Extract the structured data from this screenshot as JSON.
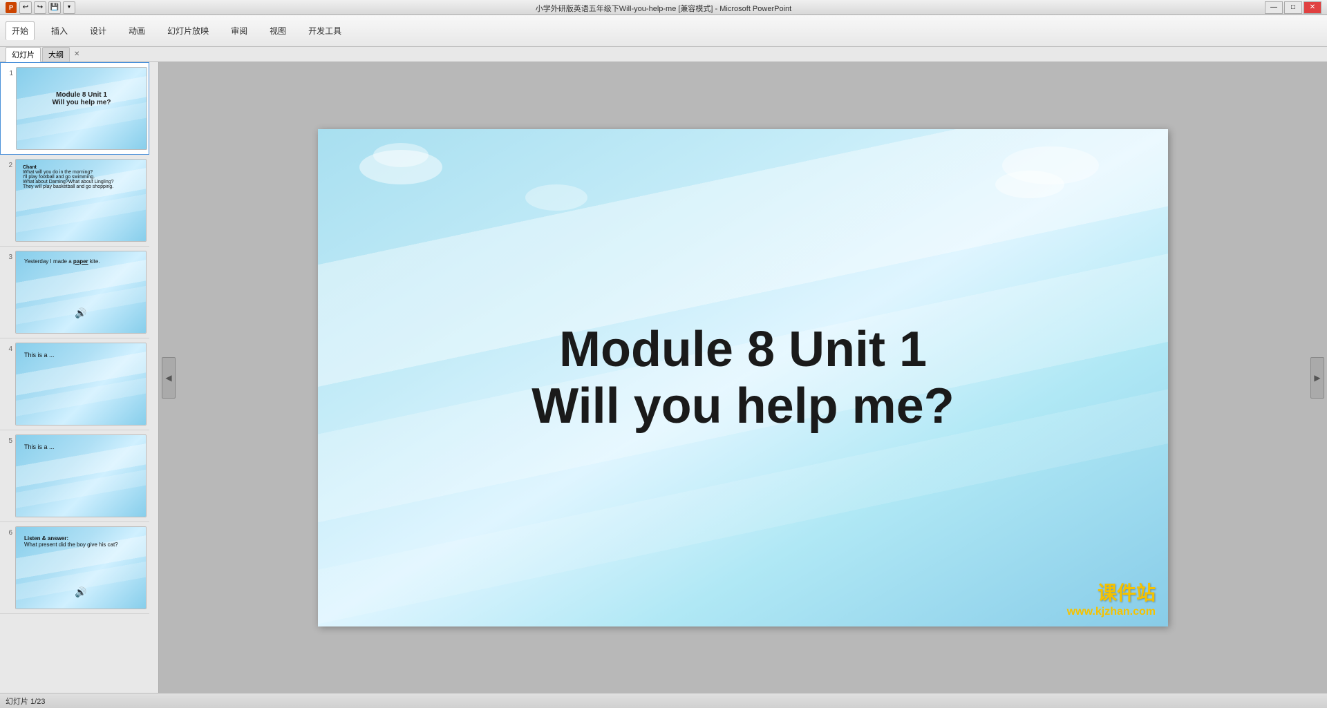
{
  "window": {
    "title": "小学外研版英语五年级下Will-you-help-me [兼容模式] - Microsoft PowerPoint",
    "icon_label": "P"
  },
  "titlebar": {
    "quick_access": [
      "↩",
      "↪",
      "💾"
    ],
    "controls": [
      "—",
      "□",
      "✕"
    ]
  },
  "ribbon": {
    "tabs": [
      "开始",
      "插入",
      "设计",
      "动画",
      "幻灯片放映",
      "审阅",
      "视图",
      "开发工具"
    ]
  },
  "panel_tabs": {
    "tabs": [
      "幻灯片",
      "大纲"
    ]
  },
  "slides": [
    {
      "num": "1",
      "title_line1": "Module 8 Unit 1",
      "title_line2": "Will you help me?"
    },
    {
      "num": "2",
      "label": "Chant",
      "content": "What will you do in the morning?\nI'll play football and go swimming.\nWhat about Daming?What about Lingling?\nThey will play basketball and go shopping."
    },
    {
      "num": "3",
      "content": "Yesterday I made a paper kite.",
      "has_speaker": true
    },
    {
      "num": "4",
      "content": "This is a ..."
    },
    {
      "num": "5",
      "content": "This is a ..."
    },
    {
      "num": "6",
      "label": "Listen & answer:",
      "content": "What present did the boy give his cat?",
      "has_speaker": true
    }
  ],
  "main_slide": {
    "line1": "Module 8 Unit 1",
    "line2": "Will you help me?"
  },
  "statusbar": {
    "slide_info": "幻灯片 1/23",
    "theme": "",
    "language": ""
  },
  "watermark": {
    "brand": "课件站",
    "url": "www.kjzhan.com"
  }
}
